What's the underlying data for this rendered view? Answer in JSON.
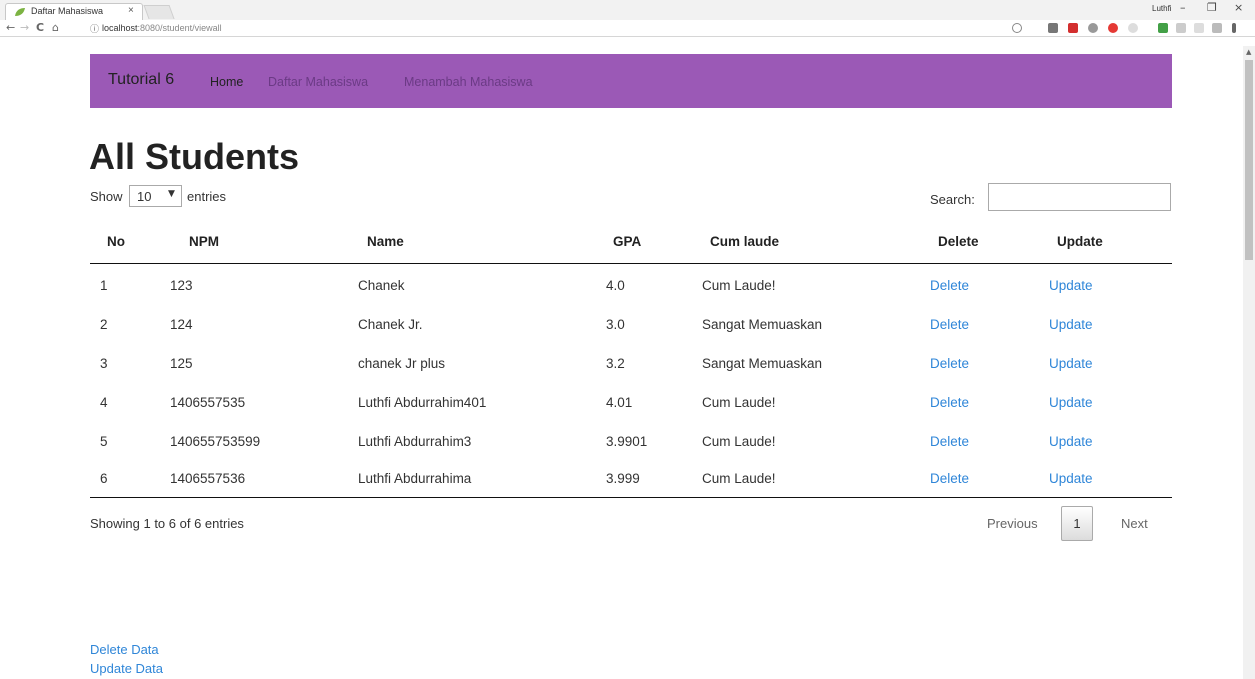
{
  "browser": {
    "tab_title": "Daftar Mahasiswa",
    "tab_close": "×",
    "url_host": "localhost",
    "url_path": ":8080/student/viewall",
    "profile": "Luthfi",
    "controls": {
      "minimize": "–",
      "restore": "❐",
      "close": "×"
    },
    "nav": {
      "back": "←",
      "forward": "→",
      "reload": "C",
      "home": "⌂",
      "info": "ⓘ"
    }
  },
  "navbar": {
    "brand": "Tutorial 6",
    "links": [
      "Home",
      "Daftar Mahasiswa",
      "Menambah Mahasiswa"
    ]
  },
  "page": {
    "title": "All Students",
    "show_label": "Show",
    "length_value": "10",
    "entries_label": "entries",
    "search_label": "Search:",
    "search_value": ""
  },
  "table": {
    "columns": [
      "No",
      "NPM",
      "Name",
      "GPA",
      "Cum laude",
      "Delete",
      "Update"
    ],
    "rows": [
      [
        "1",
        "123",
        "Chanek",
        "4.0",
        "Cum Laude!",
        "Delete",
        "Update"
      ],
      [
        "2",
        "124",
        "Chanek Jr.",
        "3.0",
        "Sangat Memuaskan",
        "Delete",
        "Update"
      ],
      [
        "3",
        "125",
        "chanek Jr plus",
        "3.2",
        "Sangat Memuaskan",
        "Delete",
        "Update"
      ],
      [
        "4",
        "1406557535",
        "Luthfi Abdurrahim401",
        "4.01",
        "Cum Laude!",
        "Delete",
        "Update"
      ],
      [
        "5",
        "140655753599",
        "Luthfi Abdurrahim3",
        "3.9901",
        "Cum Laude!",
        "Delete",
        "Update"
      ],
      [
        "6",
        "1406557536",
        "Luthfi Abdurrahima",
        "3.999",
        "Cum Laude!",
        "Delete",
        "Update"
      ]
    ]
  },
  "pagination": {
    "info": "Showing 1 to 6 of 6 entries",
    "previous": "Previous",
    "current": "1",
    "next": "Next"
  },
  "footer_links": [
    "Delete Data",
    "Update Data"
  ],
  "colors": {
    "navbar": "#9b59b6",
    "link": "#2f86d8"
  }
}
